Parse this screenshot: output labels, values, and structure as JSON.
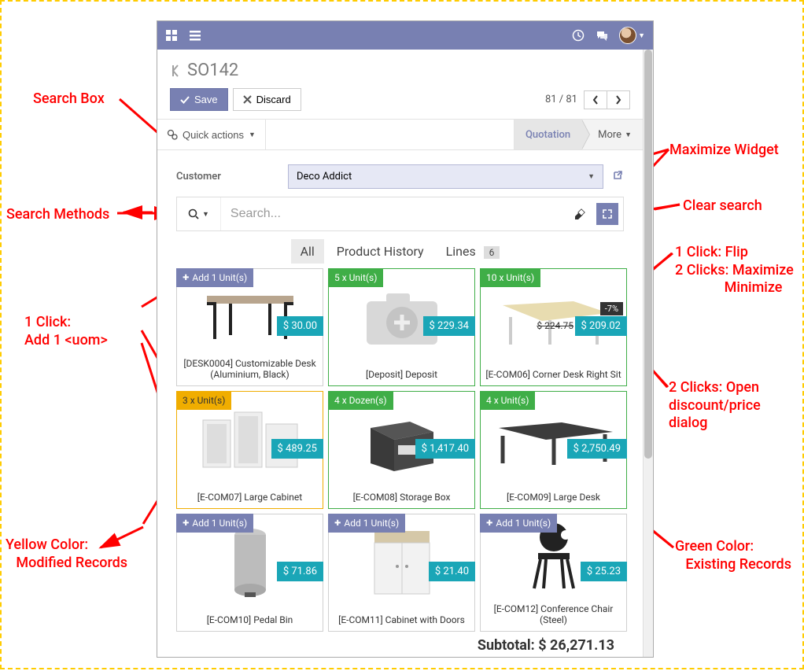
{
  "navbar": {
    "apps_icon": "apps-icon",
    "menu_icon": "menu-icon",
    "clock_icon": "clock-icon",
    "chat_icon": "chat-icon"
  },
  "breadcrumb": {
    "title": "SO142"
  },
  "actions": {
    "save_label": "Save",
    "discard_label": "Discard",
    "pager_text": "81 / 81",
    "quick_actions_label": "Quick actions"
  },
  "status": {
    "active_label": "Quotation",
    "more_label": "More"
  },
  "form": {
    "customer_label": "Customer",
    "customer_value": "Deco Addict"
  },
  "search": {
    "placeholder": "Search..."
  },
  "tabs": {
    "all": "All",
    "history": "Product History",
    "lines": "Lines",
    "lines_count": "6"
  },
  "add_unit_label": "Add 1 Unit(s)",
  "products": [
    {
      "badge_class": "bg-purple",
      "badge_text": "Add 1 Unit(s)",
      "badge_plus": true,
      "price": "$ 30.00",
      "name": "[DESK0004] Customizable Desk (Aluminium, Black)",
      "border": ""
    },
    {
      "badge_class": "bg-green",
      "badge_text": "5 x Unit(s)",
      "badge_plus": false,
      "price": "$ 229.34",
      "name": "[Deposit] Deposit",
      "border": "green"
    },
    {
      "badge_class": "bg-green",
      "badge_text": "10 x Unit(s)",
      "badge_plus": false,
      "price": "$ 209.02",
      "old_price": "$ 224.75",
      "discount": "-7%",
      "name": "[E-COM06] Corner Desk Right Sit",
      "border": "green"
    },
    {
      "badge_class": "bg-yellow",
      "badge_text": "3 x Unit(s)",
      "badge_plus": false,
      "price": "$ 489.25",
      "name": "[E-COM07] Large Cabinet",
      "border": "yellow"
    },
    {
      "badge_class": "bg-green",
      "badge_text": "4 x Dozen(s)",
      "badge_plus": false,
      "price": "$ 1,417.40",
      "name": "[E-COM08] Storage Box",
      "border": "green"
    },
    {
      "badge_class": "bg-green",
      "badge_text": "4 x Unit(s)",
      "badge_plus": false,
      "price": "$ 2,750.49",
      "name": "[E-COM09] Large Desk",
      "border": "green"
    },
    {
      "badge_class": "bg-purple",
      "badge_text": "Add 1 Unit(s)",
      "badge_plus": true,
      "price": "$ 71.86",
      "name": "[E-COM10] Pedal Bin",
      "border": ""
    },
    {
      "badge_class": "bg-purple",
      "badge_text": "Add 1 Unit(s)",
      "badge_plus": true,
      "price": "$ 21.40",
      "name": "[E-COM11] Cabinet with Doors",
      "border": ""
    },
    {
      "badge_class": "bg-purple",
      "badge_text": "Add 1 Unit(s)",
      "badge_plus": true,
      "price": "$ 25.23",
      "name": "[E-COM12] Conference Chair (Steel)",
      "border": ""
    }
  ],
  "subtotal": {
    "label": "Subtotal:",
    "value": "$ 26,271.13"
  },
  "annotations": {
    "search_box": "Search Box",
    "search_methods": "Search Methods",
    "one_click_add": "1 Click:\nAdd 1 <uom>",
    "yellow_desc": "Yellow Color:\n   Modified Records",
    "maximize_widget": "Maximize Widget",
    "clear_search": "Clear search",
    "flip_desc": "1 Click: Flip\n2 Clicks: Maximize\n              Minimize",
    "open_dialog": "2 Clicks: Open\ndiscount/price\ndialog",
    "green_desc": "Green Color:\n   Existing Records"
  }
}
